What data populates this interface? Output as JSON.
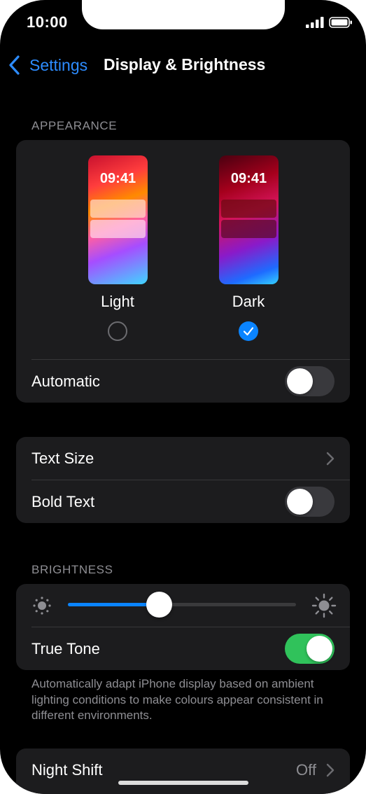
{
  "status_bar": {
    "time": "10:00",
    "signal_icon": "cellular-signal-icon",
    "battery_icon": "battery-icon"
  },
  "nav": {
    "back_label": "Settings",
    "title": "Display & Brightness"
  },
  "appearance": {
    "header": "APPEARANCE",
    "options": [
      {
        "label": "Light",
        "preview_time": "09:41",
        "selected": false
      },
      {
        "label": "Dark",
        "preview_time": "09:41",
        "selected": true
      }
    ],
    "automatic": {
      "label": "Automatic",
      "on": false
    }
  },
  "text": {
    "text_size": {
      "label": "Text Size"
    },
    "bold_text": {
      "label": "Bold Text",
      "on": false
    }
  },
  "brightness": {
    "header": "BRIGHTNESS",
    "level": 0.4,
    "true_tone": {
      "label": "True Tone",
      "on": true
    },
    "footnote": "Automatically adapt iPhone display based on ambient lighting conditions to make colours appear consistent in different environments."
  },
  "night_shift": {
    "label": "Night Shift",
    "value": "Off"
  },
  "colors": {
    "accent": "#0a84ff",
    "toggle_on": "#30c25b",
    "card_bg": "#1c1c1e",
    "secondary_text": "#8e8e93"
  }
}
